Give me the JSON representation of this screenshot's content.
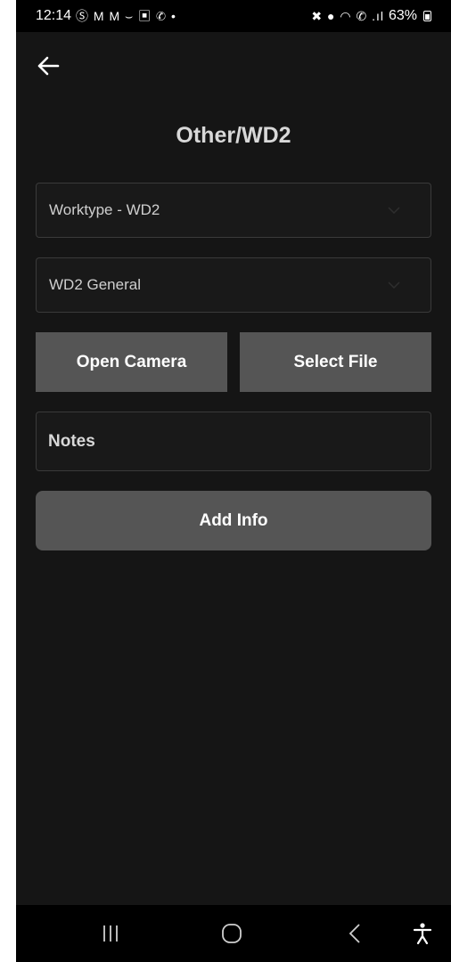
{
  "status_bar": {
    "time": "12:14",
    "left_icons": "Ⓢ M M ⌣ ▣ ✆ •",
    "right_icons": "✖ ● ◠ ✆ .ıl",
    "battery": "63%"
  },
  "header": {
    "back_icon": "arrow-left-icon",
    "title": "Other/WD2"
  },
  "form": {
    "worktype_select": {
      "value": "Worktype - WD2"
    },
    "category_select": {
      "value": "WD2 General"
    },
    "open_camera_label": "Open Camera",
    "select_file_label": "Select File",
    "notes_placeholder": "Notes",
    "add_info_label": "Add Info"
  },
  "nav_bar": {
    "icons": [
      "recent-apps-icon",
      "home-icon",
      "back-icon",
      "accessibility-icon"
    ]
  },
  "colors": {
    "background": "#151515",
    "button": "#555555",
    "field_border": "#3a3a3a",
    "text": "#d8d8d8"
  }
}
